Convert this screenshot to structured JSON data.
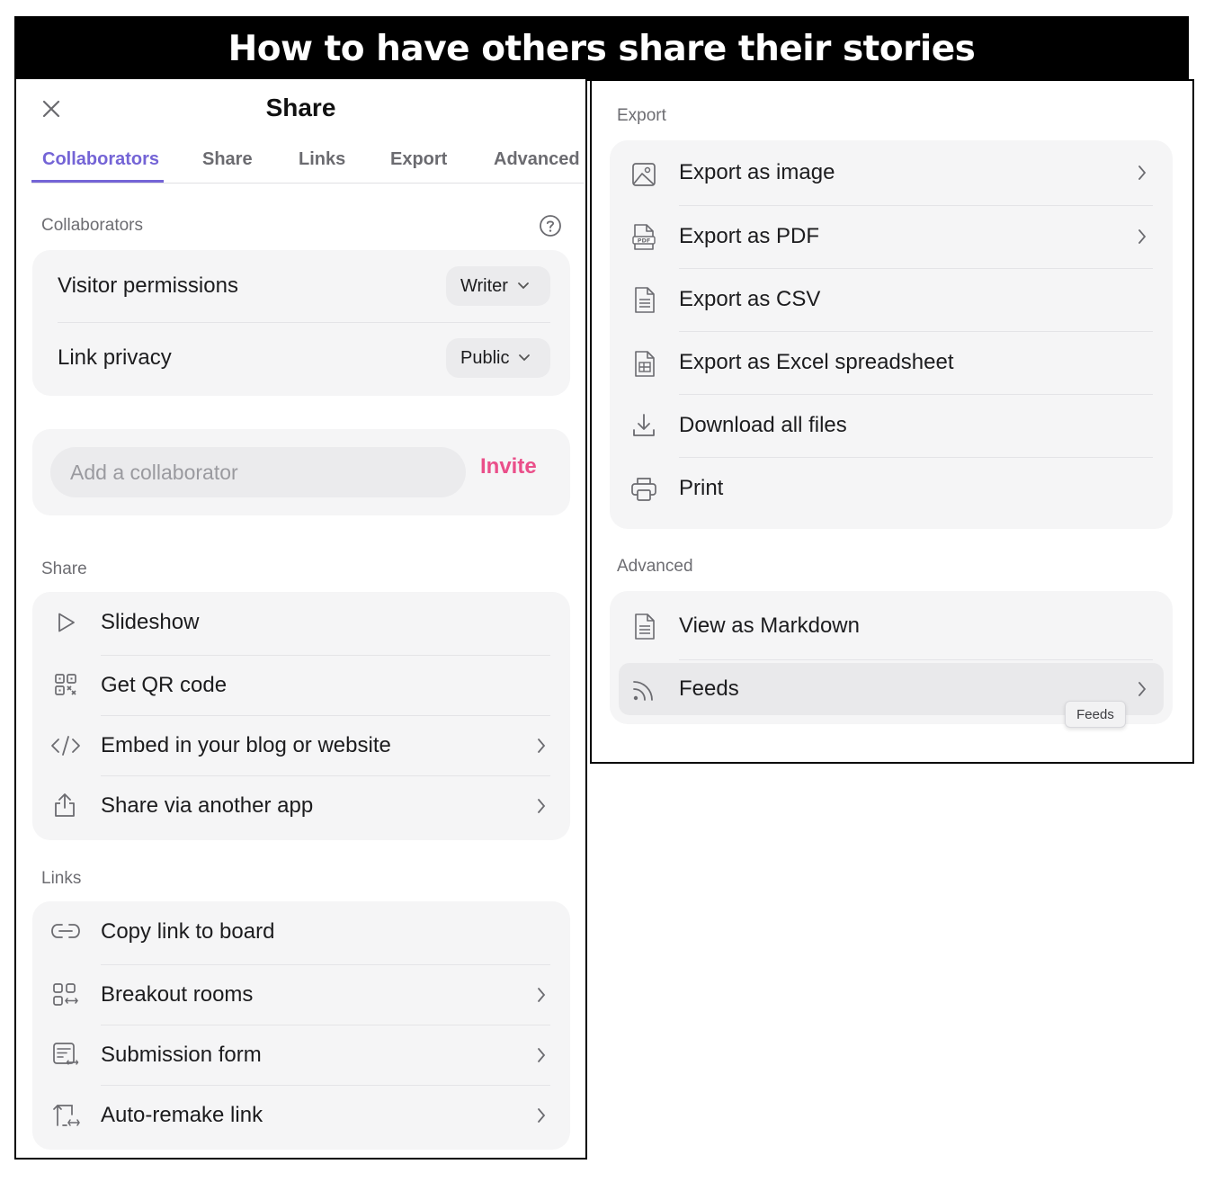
{
  "banner": {
    "title": "How to have others share their stories"
  },
  "dialog": {
    "title": "Share",
    "tabs": [
      {
        "label": "Collaborators",
        "active": true
      },
      {
        "label": "Share",
        "active": false
      },
      {
        "label": "Links",
        "active": false
      },
      {
        "label": "Export",
        "active": false
      },
      {
        "label": "Advanced",
        "active": false
      }
    ]
  },
  "collaborators": {
    "section_label": "Collaborators",
    "visitor_permissions": {
      "label": "Visitor permissions",
      "value": "Writer"
    },
    "link_privacy": {
      "label": "Link privacy",
      "value": "Public"
    },
    "add_collaborator": {
      "placeholder": "Add a collaborator",
      "button": "Invite"
    }
  },
  "share": {
    "section_label": "Share",
    "items": [
      {
        "label": "Slideshow",
        "icon": "play-icon",
        "chevron": false
      },
      {
        "label": "Get QR code",
        "icon": "qr-code-icon",
        "chevron": false
      },
      {
        "label": "Embed in your blog or website",
        "icon": "code-icon",
        "chevron": true
      },
      {
        "label": "Share via another app",
        "icon": "share-icon",
        "chevron": true
      }
    ]
  },
  "links": {
    "section_label": "Links",
    "items": [
      {
        "label": "Copy link to board",
        "icon": "link-icon",
        "chevron": false
      },
      {
        "label": "Breakout rooms",
        "icon": "breakout-icon",
        "chevron": true
      },
      {
        "label": "Submission form",
        "icon": "form-icon",
        "chevron": true
      },
      {
        "label": "Auto-remake link",
        "icon": "remake-icon",
        "chevron": true
      }
    ]
  },
  "export": {
    "section_label": "Export",
    "items": [
      {
        "label": "Export as image",
        "icon": "image-icon",
        "chevron": true
      },
      {
        "label": "Export as PDF",
        "icon": "pdf-icon",
        "chevron": true
      },
      {
        "label": "Export as CSV",
        "icon": "csv-icon",
        "chevron": false
      },
      {
        "label": "Export as Excel spreadsheet",
        "icon": "excel-icon",
        "chevron": false
      },
      {
        "label": "Download all files",
        "icon": "download-icon",
        "chevron": false
      },
      {
        "label": "Print",
        "icon": "printer-icon",
        "chevron": false
      }
    ]
  },
  "advanced": {
    "section_label": "Advanced",
    "items": [
      {
        "label": "View as Markdown",
        "icon": "markdown-icon",
        "chevron": false
      },
      {
        "label": "Feeds",
        "icon": "rss-icon",
        "chevron": true,
        "hovered": true
      }
    ],
    "tooltip": "Feeds"
  },
  "colors": {
    "accent": "#7464d6",
    "invite": "#ea4f8a",
    "card_bg": "#f5f5f6"
  }
}
